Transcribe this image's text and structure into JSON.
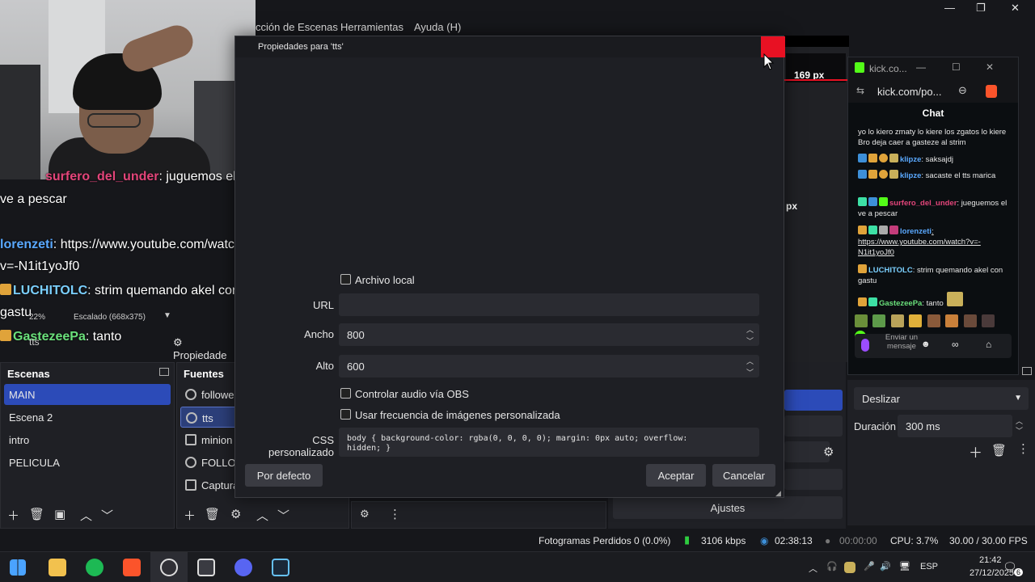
{
  "window": {
    "menu": [
      "cción de Escenas",
      "Herramientas",
      "Ayuda (H)"
    ],
    "controls": {
      "minimize": "—",
      "maximize": "❐",
      "close": "✕"
    }
  },
  "preview": {
    "size_label": "169 px",
    "size_label_small": "px",
    "zoom": "22%",
    "scaling": "Escalado (668x375)",
    "props_button": "Propiedade",
    "source_name": "tts"
  },
  "chat_overlay": [
    {
      "user": "surfero_del_under",
      "text": ": juguemos el",
      "user_color": "#e3457a"
    },
    {
      "user": "",
      "text": "ve a pescar",
      "user_color": "#ffffff"
    },
    {
      "user": "lorenzeti",
      "text": ": https://www.youtube.com/watch?",
      "user_color": "#5aa9ff"
    },
    {
      "user": "",
      "text": "v=-N1it1yoJf0",
      "user_color": "#ffffff"
    },
    {
      "user": "LUCHITOLC",
      "text": ": strim quemando akel con",
      "user_color": "#7bd0ff"
    },
    {
      "user": "",
      "text": "gastu",
      "user_color": "#ffffff"
    },
    {
      "user": "GastezeePa",
      "text": ": tanto",
      "user_color": "#6ae07b"
    }
  ],
  "dialog": {
    "title": "Propiedades para 'tts'",
    "fields": {
      "local_file_label": "Archivo local",
      "url_label": "URL",
      "url_value": "",
      "width_label": "Ancho",
      "width_value": "800",
      "height_label": "Alto",
      "height_value": "600",
      "audio_label": "Controlar audio vía OBS",
      "fps_label": "Usar frecuencia de imágenes personalizada",
      "css_label": "CSS personalizado",
      "css_value": "body { background-color: rgba(0, 0, 0, 0); margin: 0px auto; overflow:\nhidden; }"
    },
    "buttons": {
      "defaults": "Por defecto",
      "accept": "Aceptar",
      "cancel": "Cancelar"
    }
  },
  "scenes": {
    "title": "Escenas",
    "items": [
      "MAIN",
      "Escena 2",
      "intro",
      "PELICULA"
    ],
    "selected": "MAIN"
  },
  "sources": {
    "title": "Fuentes",
    "items": [
      "followe",
      "tts",
      "minion",
      "FOLLOW",
      "Captura"
    ],
    "selected": "tts"
  },
  "transitions": {
    "type": "Deslizar",
    "duration_label": "Duración",
    "duration_value": "300 ms",
    "settings_button": "Ajustes"
  },
  "browser": {
    "tab_title": "kick.co...",
    "url": "kick.com/po...",
    "chat_title": "Chat",
    "messages": [
      {
        "user": "",
        "text": "yo lo kiero zmaty lo kiere los zgatos lo kiere Bro deja caer a gasteze al strim",
        "color": "#e6e6e6"
      },
      {
        "user": "klipze",
        "text": ": saksajdj",
        "color": "#5aa9ff"
      },
      {
        "user": "klipze",
        "text": ": sacaste el tts marica",
        "color": "#5aa9ff"
      },
      {
        "user": "surfero_del_under",
        "text": ": jueguemos el ve a pescar",
        "color": "#e3457a"
      },
      {
        "user": "lorenzeti",
        "text": ": https://www.youtube.com/watch?v=-N1it1yoJf0",
        "color": "#5aa9ff"
      },
      {
        "user": "LUCHITOLC",
        "text": ": strim quemando akel con gastu",
        "color": "#7bd0ff"
      },
      {
        "user": "GastezeePa",
        "text": ": tanto",
        "color": "#6ae07b"
      }
    ],
    "send_placeholder": "Enviar un mensaje"
  },
  "status": {
    "dropped": "Fotogramas Perdidos 0 (0.0%)",
    "bitrate": "3106 kbps",
    "live_time": "02:38:13",
    "rec_time": "00:00:00",
    "cpu": "CPU: 3.7%",
    "fps": "30.00 / 30.00 FPS"
  },
  "taskbar": {
    "lang": "ESP",
    "time": "21:42",
    "date": "27/12/2025",
    "notifications": "6"
  },
  "colors": {
    "accent": "#2c4bb8",
    "close_red": "#e81123",
    "bitrate_green": "#2ecc40"
  }
}
